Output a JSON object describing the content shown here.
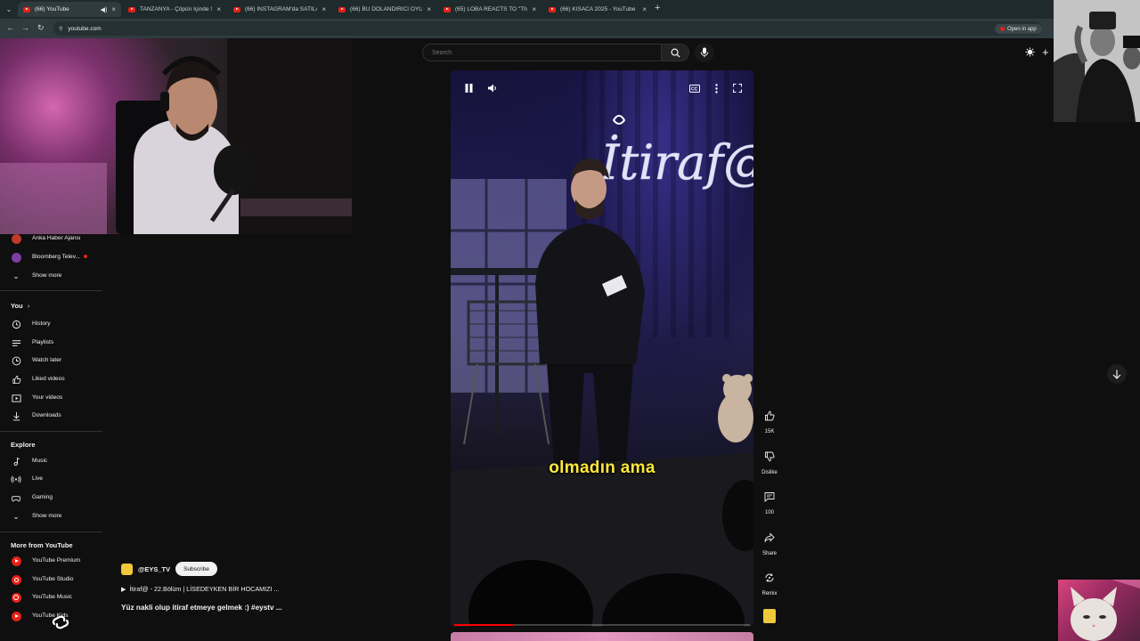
{
  "browser": {
    "tabs": [
      {
        "title": "(66) YouTube",
        "active": true
      },
      {
        "title": "TANZANYA - Çöpün İçinde SATI",
        "active": false
      },
      {
        "title": "(66) INSTAGRAM'da SATILAN S",
        "active": false
      },
      {
        "title": "(66) BU DOLANDIRICI OYUNU",
        "active": false
      },
      {
        "title": "(65) LOBA REACTS TO \"The REI",
        "active": false
      },
      {
        "title": "(66) KISACA 2025 - YouTube",
        "active": false
      }
    ],
    "url": "youtube.com",
    "open_in_app": "Open in app"
  },
  "search": {
    "placeholder": "Search"
  },
  "sidebar": {
    "subscriptions": [
      {
        "label": "Anka Haber Ajansı",
        "avatar_color": "#c0392b"
      },
      {
        "label": "Bloomberg Telev...",
        "avatar_color": "#7b3fa0"
      }
    ],
    "show_more_1": "Show more",
    "you_title": "You",
    "you_items": [
      {
        "label": "History",
        "icon": "history-icon"
      },
      {
        "label": "Playlists",
        "icon": "playlists-icon"
      },
      {
        "label": "Watch later",
        "icon": "clock-icon"
      },
      {
        "label": "Liked videos",
        "icon": "thumbs-up-icon"
      },
      {
        "label": "Your videos",
        "icon": "video-icon"
      },
      {
        "label": "Downloads",
        "icon": "download-icon"
      }
    ],
    "explore_title": "Explore",
    "explore_items": [
      {
        "label": "Music",
        "icon": "music-note-icon"
      },
      {
        "label": "Live",
        "icon": "live-icon"
      },
      {
        "label": "Gaming",
        "icon": "gamepad-icon"
      }
    ],
    "show_more_2": "Show more",
    "more_title": "More from YouTube",
    "more_items": [
      {
        "label": "YouTube Premium"
      },
      {
        "label": "YouTube Studio"
      },
      {
        "label": "YouTube Music"
      },
      {
        "label": "YouTube Kids"
      }
    ]
  },
  "player": {
    "caption": "olmadın ama",
    "progress": 0.2,
    "neon_sign": "İtiraf@"
  },
  "actions": {
    "like_count": "15K",
    "dislike_label": "Dislike",
    "comment_count": "100",
    "share_label": "Share",
    "remix_label": "Remix"
  },
  "video": {
    "channel": "@EYS_TV",
    "subscribe": "Subscribe",
    "related": "İtiraf@ - 22.Bölüm | LİSEDEYKEN BİR HOCAMIZI ...",
    "title": "Yüz nakli olup itiraf etmeye gelmek :) #eystv ..."
  },
  "colors": {
    "accent_red": "#ff0000",
    "caption_yellow": "#ffe83b",
    "background": "#0f0f0f"
  }
}
